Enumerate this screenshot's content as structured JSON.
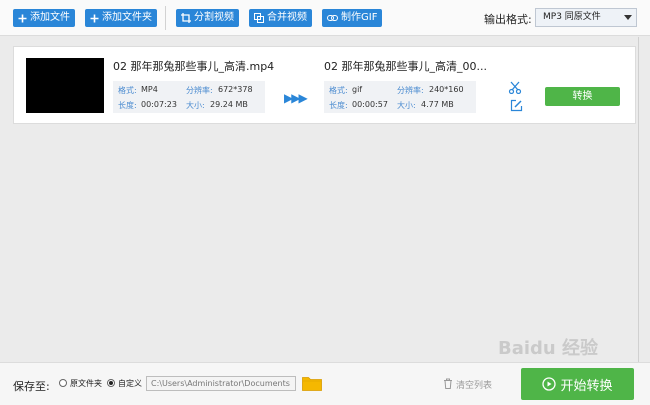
{
  "toolbar": {
    "add_file": "添加文件",
    "add_folder": "添加文件夹",
    "split_video": "分割视频",
    "merge_video": "合并视频",
    "make_gif": "制作GIF",
    "output_format_label": "输出格式:",
    "output_format_value": "MP3  同原文件"
  },
  "item": {
    "source": {
      "name": "02 那年那兔那些事儿_高清.mp4",
      "format_label": "格式:",
      "format": "MP4",
      "resolution_label": "分辨率:",
      "resolution": "672*378",
      "duration_label": "长度:",
      "duration": "00:07:23",
      "size_label": "大小:",
      "size": "29.24 MB"
    },
    "target": {
      "name": "02 那年那兔那些事儿_高清_00...",
      "format_label": "格式:",
      "format": "gif",
      "resolution_label": "分辨率:",
      "resolution": "240*160",
      "duration_label": "长度:",
      "duration": "00:00:57",
      "size_label": "大小:",
      "size": "4.77 MB"
    },
    "convert_label": "转换"
  },
  "bottom": {
    "save_to_label": "保存至:",
    "option_original": "原文件夹",
    "option_custom": "自定义",
    "selected_option": "custom",
    "path": "C:\\Users\\Administrator\\Documents",
    "clear_list": "清空列表",
    "start_convert": "开始转换"
  },
  "watermark": "Baidu 经验",
  "colors": {
    "toolbar_button": "#2a86d8",
    "convert_green": "#4fb548",
    "info_key": "#4a8bd0"
  }
}
